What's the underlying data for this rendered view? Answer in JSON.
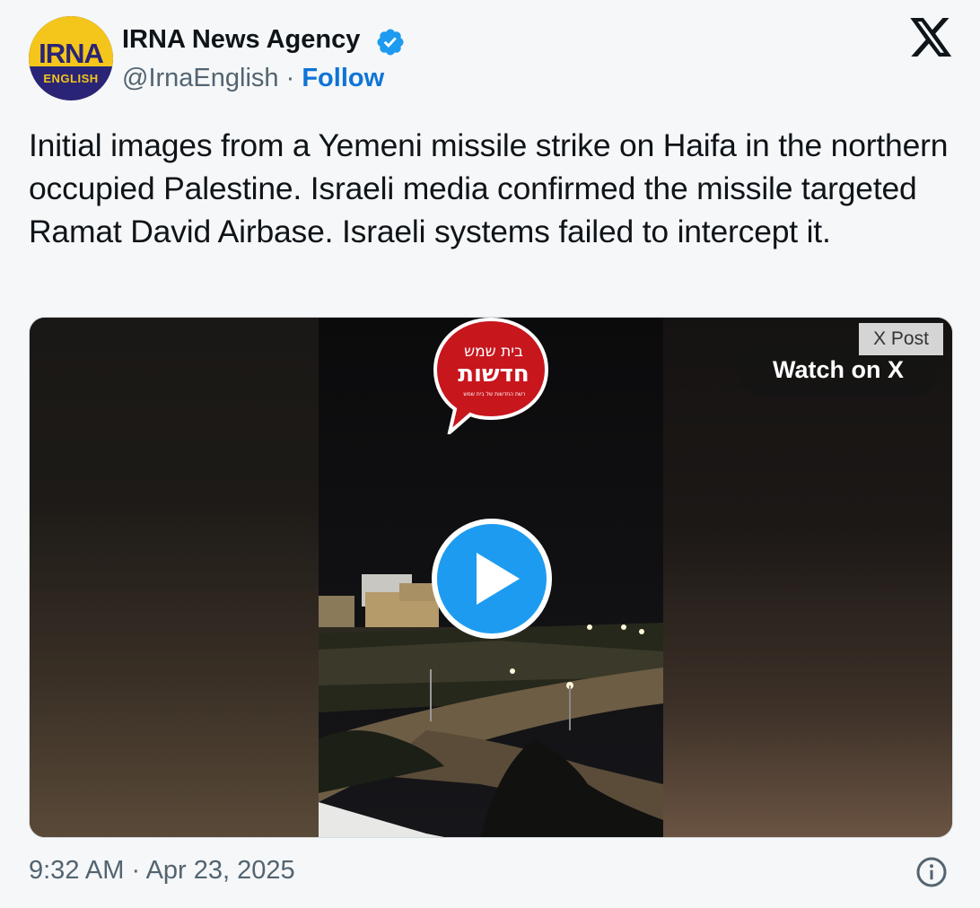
{
  "author": {
    "avatar_text_top": "IRNA",
    "avatar_text_bottom": "ENGLISH",
    "name": "IRNA News Agency",
    "handle": "@IrnaEnglish",
    "separator": "·",
    "follow_label": "Follow"
  },
  "tweet": {
    "text": "Initial images from a Yemeni missile strike on Haifa in the northern occupied Palestine. Israeli media confirmed the missile targeted Ramat David Airbase. Israeli systems failed to intercept it."
  },
  "media": {
    "badge": "X Post",
    "watch_label": "Watch on X",
    "logo_text_top": "בית שמש",
    "logo_text_main": "חדשות",
    "logo_text_small": "רשת החדשות של בית שמש"
  },
  "footer": {
    "timestamp": "9:32 AM · Apr 23, 2025"
  },
  "colors": {
    "accent": "#1d9bf0",
    "follow": "#0f74d6",
    "secondary_text": "#536471",
    "logo_red": "#c8161d"
  },
  "icons": {
    "verified": "verified-badge-icon",
    "x_logo": "x-logo-icon",
    "play": "play-icon",
    "info": "info-icon"
  }
}
